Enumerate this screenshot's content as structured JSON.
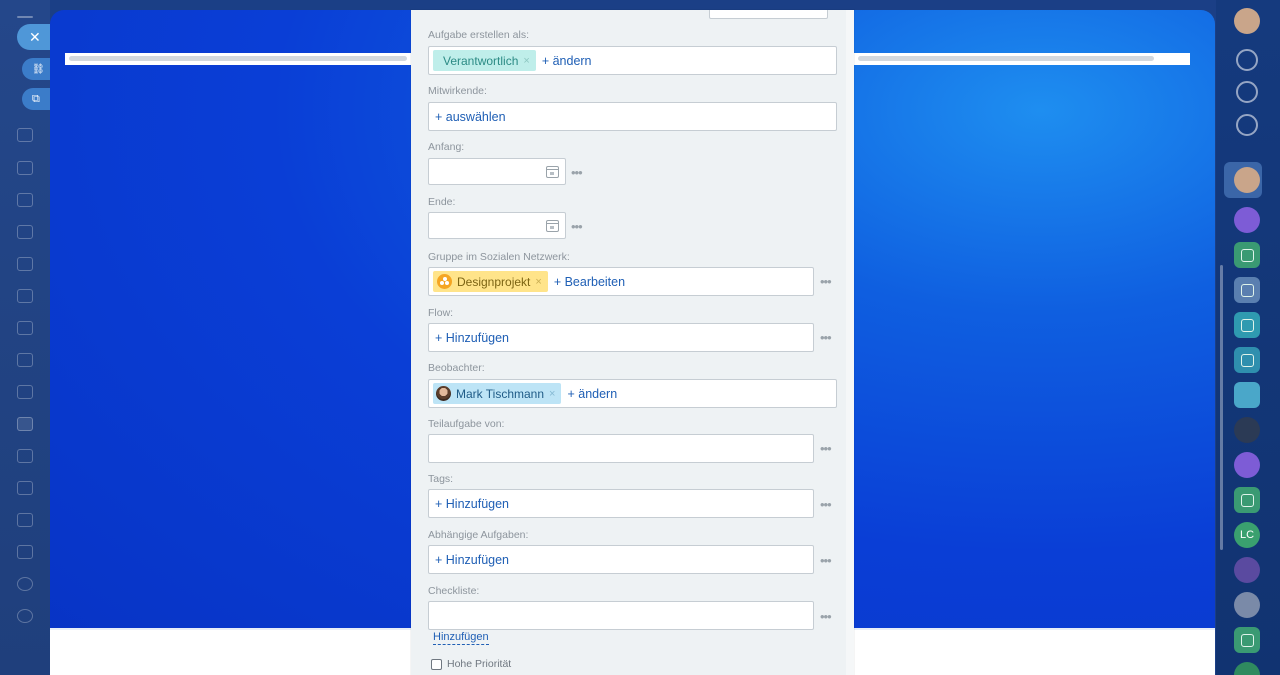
{
  "form": {
    "create_as_label": "Aufgabe erstellen als:",
    "responsible_chip": "Verantwortlich",
    "change_link": "+ ändern",
    "participants_label": "Mitwirkende:",
    "participants_link": "+ auswählen",
    "start_label": "Anfang:",
    "end_label": "Ende:",
    "group_label": "Gruppe im Sozialen Netzwerk:",
    "group_chip": "Designprojekt",
    "group_edit_link": "+ Bearbeiten",
    "flow_label": "Flow:",
    "add_link": "+ Hinzufügen",
    "observers_label": "Beobachter:",
    "observer_chip": "Mark Tischmann",
    "observer_change_link": "+ ändern",
    "subtask_label": "Teilaufgabe von:",
    "tags_label": "Tags:",
    "dependent_label": "Abhängige Aufgaben:",
    "checklist_label": "Checkliste:",
    "checklist_add": "Hinzufügen",
    "priority_label": "Hohe Priorität",
    "chip_remove": "×",
    "more_dots": "•••"
  },
  "sidebar": {
    "close_icon": "✕",
    "link_icon": "🔗",
    "open_icon": "⧉"
  },
  "right_bar": {
    "avatar_initials": "LC"
  },
  "colors": {
    "link": "#1f5fb5",
    "chip_teal": "#bfeeea",
    "chip_yellow": "#ffe48a",
    "chip_blue": "#bde4f6",
    "panel_bg": "#eef2f4"
  }
}
